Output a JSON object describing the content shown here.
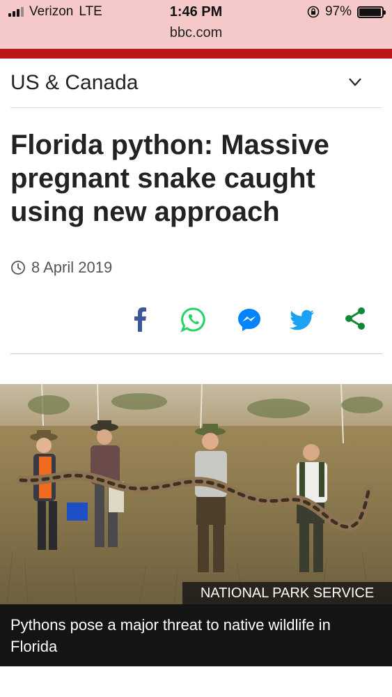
{
  "status_bar": {
    "carrier": "Verizon",
    "network": "LTE",
    "time": "1:46 PM",
    "battery": "97%",
    "battery_level": 0.97,
    "url": "bbc.com"
  },
  "colors": {
    "brand_red": "#bb1919",
    "status_bg": "#f5c9c9"
  },
  "section": {
    "title": "US & Canada"
  },
  "article": {
    "headline": "Florida python: Massive pregnant snake caught using new approach",
    "date": "8 April 2019"
  },
  "share": {
    "icons": [
      "facebook-icon",
      "whatsapp-icon",
      "messenger-icon",
      "twitter-icon",
      "share-icon"
    ]
  },
  "image": {
    "credit": "NATIONAL PARK SERVICE",
    "caption": "Pythons pose a major threat to native wildlife in Florida"
  }
}
